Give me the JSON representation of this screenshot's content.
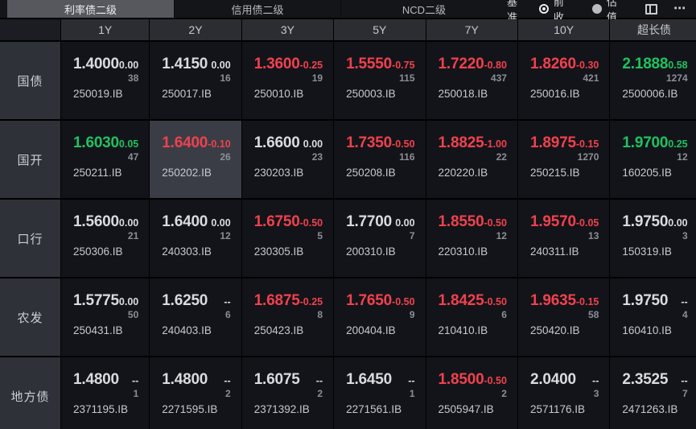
{
  "topbar": {
    "tabs": [
      {
        "label": "利率债二级",
        "active": true
      },
      {
        "label": "信用债二级",
        "active": false
      },
      {
        "label": "NCD二级",
        "active": false
      }
    ],
    "benchmark_label": "基准",
    "radios": [
      {
        "label": "前收",
        "checked": true
      },
      {
        "label": "估值",
        "checked": false
      }
    ],
    "icons": [
      "panel-layout-icon",
      "more-icon"
    ]
  },
  "table": {
    "columns": [
      "1Y",
      "2Y",
      "3Y",
      "5Y",
      "7Y",
      "10Y",
      "超长债"
    ],
    "rows": [
      {
        "label": "国债",
        "cells": [
          {
            "yield": "1.4000",
            "change": "0.00",
            "count": "38",
            "code": "250019.IB",
            "trend": "flat"
          },
          {
            "yield": "1.4150",
            "change": "0.00",
            "count": "16",
            "code": "250017.IB",
            "trend": "flat"
          },
          {
            "yield": "1.3600",
            "change": "-0.25",
            "count": "19",
            "code": "250010.IB",
            "trend": "down"
          },
          {
            "yield": "1.5550",
            "change": "-0.75",
            "count": "115",
            "code": "250003.IB",
            "trend": "down"
          },
          {
            "yield": "1.7220",
            "change": "-0.80",
            "count": "437",
            "code": "250018.IB",
            "trend": "down"
          },
          {
            "yield": "1.8260",
            "change": "-0.30",
            "count": "421",
            "code": "250016.IB",
            "trend": "down"
          },
          {
            "yield": "2.1888",
            "change": "0.58",
            "count": "1274",
            "code": "2500006.IB",
            "trend": "up"
          }
        ]
      },
      {
        "label": "国开",
        "cells": [
          {
            "yield": "1.6030",
            "change": "0.05",
            "count": "47",
            "code": "250211.IB",
            "trend": "up"
          },
          {
            "yield": "1.6400",
            "change": "-0.10",
            "count": "26",
            "code": "250202.IB",
            "trend": "down",
            "selected": true
          },
          {
            "yield": "1.6600",
            "change": "0.00",
            "count": "23",
            "code": "230203.IB",
            "trend": "flat"
          },
          {
            "yield": "1.7350",
            "change": "-0.50",
            "count": "116",
            "code": "250208.IB",
            "trend": "down"
          },
          {
            "yield": "1.8825",
            "change": "-1.00",
            "count": "22",
            "code": "220220.IB",
            "trend": "down"
          },
          {
            "yield": "1.8975",
            "change": "-0.15",
            "count": "1270",
            "code": "250215.IB",
            "trend": "down"
          },
          {
            "yield": "1.9700",
            "change": "0.25",
            "count": "12",
            "code": "160205.IB",
            "trend": "up"
          }
        ]
      },
      {
        "label": "口行",
        "cells": [
          {
            "yield": "1.5600",
            "change": "0.00",
            "count": "21",
            "code": "250306.IB",
            "trend": "flat"
          },
          {
            "yield": "1.6400",
            "change": "0.00",
            "count": "12",
            "code": "240303.IB",
            "trend": "flat"
          },
          {
            "yield": "1.6750",
            "change": "-0.50",
            "count": "5",
            "code": "230305.IB",
            "trend": "down"
          },
          {
            "yield": "1.7700",
            "change": "0.00",
            "count": "7",
            "code": "200310.IB",
            "trend": "flat"
          },
          {
            "yield": "1.8550",
            "change": "-0.50",
            "count": "12",
            "code": "220310.IB",
            "trend": "down"
          },
          {
            "yield": "1.9570",
            "change": "-0.05",
            "count": "13",
            "code": "240311.IB",
            "trend": "down"
          },
          {
            "yield": "1.9750",
            "change": "0.00",
            "count": "3",
            "code": "150319.IB",
            "trend": "flat"
          }
        ]
      },
      {
        "label": "农发",
        "cells": [
          {
            "yield": "1.5775",
            "change": "0.00",
            "count": "50",
            "code": "250431.IB",
            "trend": "flat"
          },
          {
            "yield": "1.6250",
            "change": "--",
            "count": "6",
            "code": "240403.IB",
            "trend": "flat"
          },
          {
            "yield": "1.6875",
            "change": "-0.25",
            "count": "8",
            "code": "250423.IB",
            "trend": "down"
          },
          {
            "yield": "1.7650",
            "change": "-0.50",
            "count": "9",
            "code": "200404.IB",
            "trend": "down"
          },
          {
            "yield": "1.8425",
            "change": "-0.50",
            "count": "6",
            "code": "210410.IB",
            "trend": "down"
          },
          {
            "yield": "1.9635",
            "change": "-0.15",
            "count": "58",
            "code": "250420.IB",
            "trend": "down"
          },
          {
            "yield": "1.9750",
            "change": "--",
            "count": "4",
            "code": "160410.IB",
            "trend": "flat"
          }
        ]
      },
      {
        "label": "地方债",
        "cells": [
          {
            "yield": "1.4800",
            "change": "--",
            "count": "1",
            "code": "2371195.IB",
            "trend": "flat"
          },
          {
            "yield": "1.4800",
            "change": "--",
            "count": "2",
            "code": "2271595.IB",
            "trend": "flat"
          },
          {
            "yield": "1.6075",
            "change": "--",
            "count": "2",
            "code": "2371392.IB",
            "trend": "flat"
          },
          {
            "yield": "1.6450",
            "change": "--",
            "count": "1",
            "code": "2271561.IB",
            "trend": "flat"
          },
          {
            "yield": "1.8500",
            "change": "-0.50",
            "count": "2",
            "code": "2505947.IB",
            "trend": "down"
          },
          {
            "yield": "2.0400",
            "change": "--",
            "count": "3",
            "code": "2571176.IB",
            "trend": "flat"
          },
          {
            "yield": "2.3525",
            "change": "--",
            "count": "7",
            "code": "2471263.IB",
            "trend": "flat"
          }
        ]
      }
    ]
  },
  "colors": {
    "up": "#1fc261",
    "down": "#f0414e",
    "flat": "#d9dbdf"
  }
}
